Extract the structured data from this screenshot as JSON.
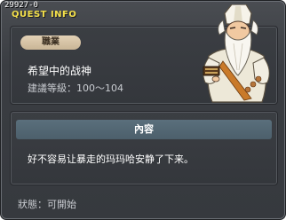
{
  "quest_id": "29927-0",
  "window_title": "QUEST INFO",
  "job": {
    "badge_label": "職業",
    "quest_name": "希望中的战神",
    "level_range": "建議等級：100～104"
  },
  "content": {
    "header": "內容",
    "text": "好不容易让暴走的玛玛哈安静了下来。"
  },
  "status": "狀態：可開始",
  "npc": {
    "icon": "elder-sage-npc-sprite"
  },
  "colors": {
    "title_yellow": "#f4e04b",
    "panel_bg": "#383b40",
    "badge_bg": "#d8c7aa",
    "header_bg": "#53677a"
  }
}
